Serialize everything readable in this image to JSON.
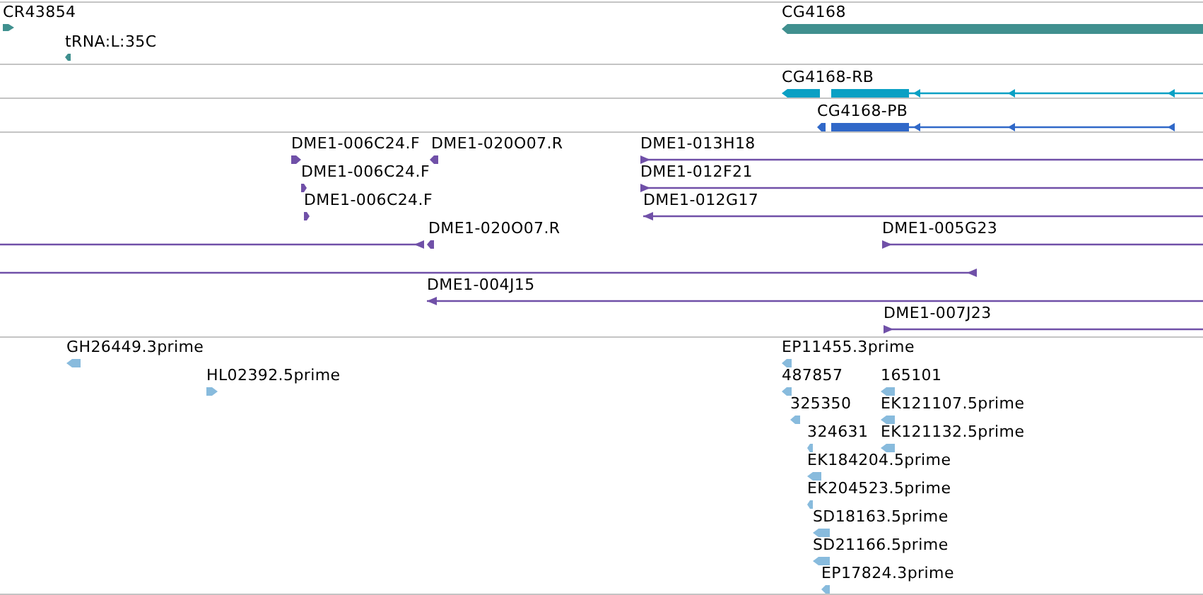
{
  "tracks": [
    {
      "kind": "gene",
      "features": [
        {
          "label": "CR43854",
          "reverse": false
        },
        {
          "label": "tRNA:L:35C",
          "reverse": true
        },
        {
          "label": "CG4168",
          "reverse": true
        }
      ]
    },
    {
      "kind": "transcript",
      "features": [
        {
          "label": "CG4168-RB",
          "reverse": true
        }
      ]
    },
    {
      "kind": "protein",
      "features": [
        {
          "label": "CG4168-PB",
          "reverse": true
        }
      ]
    },
    {
      "kind": "clone",
      "features": [
        {
          "label": "DME1-006C24.F",
          "reverse": false
        },
        {
          "label": "DME1-020O07.R",
          "reverse": true
        },
        {
          "label": "DME1-013H18",
          "reverse": false
        },
        {
          "label": "DME1-006C24.F",
          "reverse": false
        },
        {
          "label": "DME1-012F21",
          "reverse": false
        },
        {
          "label": "DME1-006C24.F",
          "reverse": false
        },
        {
          "label": "DME1-012G17",
          "reverse": true
        },
        {
          "reverse": true
        },
        {
          "label": "DME1-020O07.R",
          "reverse": true
        },
        {
          "label": "DME1-005G23",
          "reverse": false
        },
        {
          "reverse": true
        },
        {
          "label": "DME1-004J15",
          "reverse": true
        },
        {
          "label": "DME1-007J23",
          "reverse": false
        }
      ]
    },
    {
      "kind": "est",
      "features": [
        {
          "label": "GH26449.3prime",
          "reverse": true
        },
        {
          "label": "HL02392.5prime",
          "reverse": false
        },
        {
          "label": "EP11455.3prime",
          "reverse": true
        },
        {
          "label": "487857",
          "reverse": true
        },
        {
          "label": "165101",
          "reverse": true
        },
        {
          "label": "325350",
          "reverse": true
        },
        {
          "label": "EK121107.5prime",
          "reverse": true
        },
        {
          "label": "324631",
          "reverse": true
        },
        {
          "label": "EK121132.5prime",
          "reverse": true
        },
        {
          "label": "EK184204.5prime",
          "reverse": true
        },
        {
          "label": "EK204523.5prime",
          "reverse": true
        },
        {
          "label": "SD18163.5prime",
          "reverse": true
        },
        {
          "label": "SD21166.5prime",
          "reverse": true
        },
        {
          "label": "EP17824.3prime",
          "reverse": true
        }
      ]
    }
  ]
}
